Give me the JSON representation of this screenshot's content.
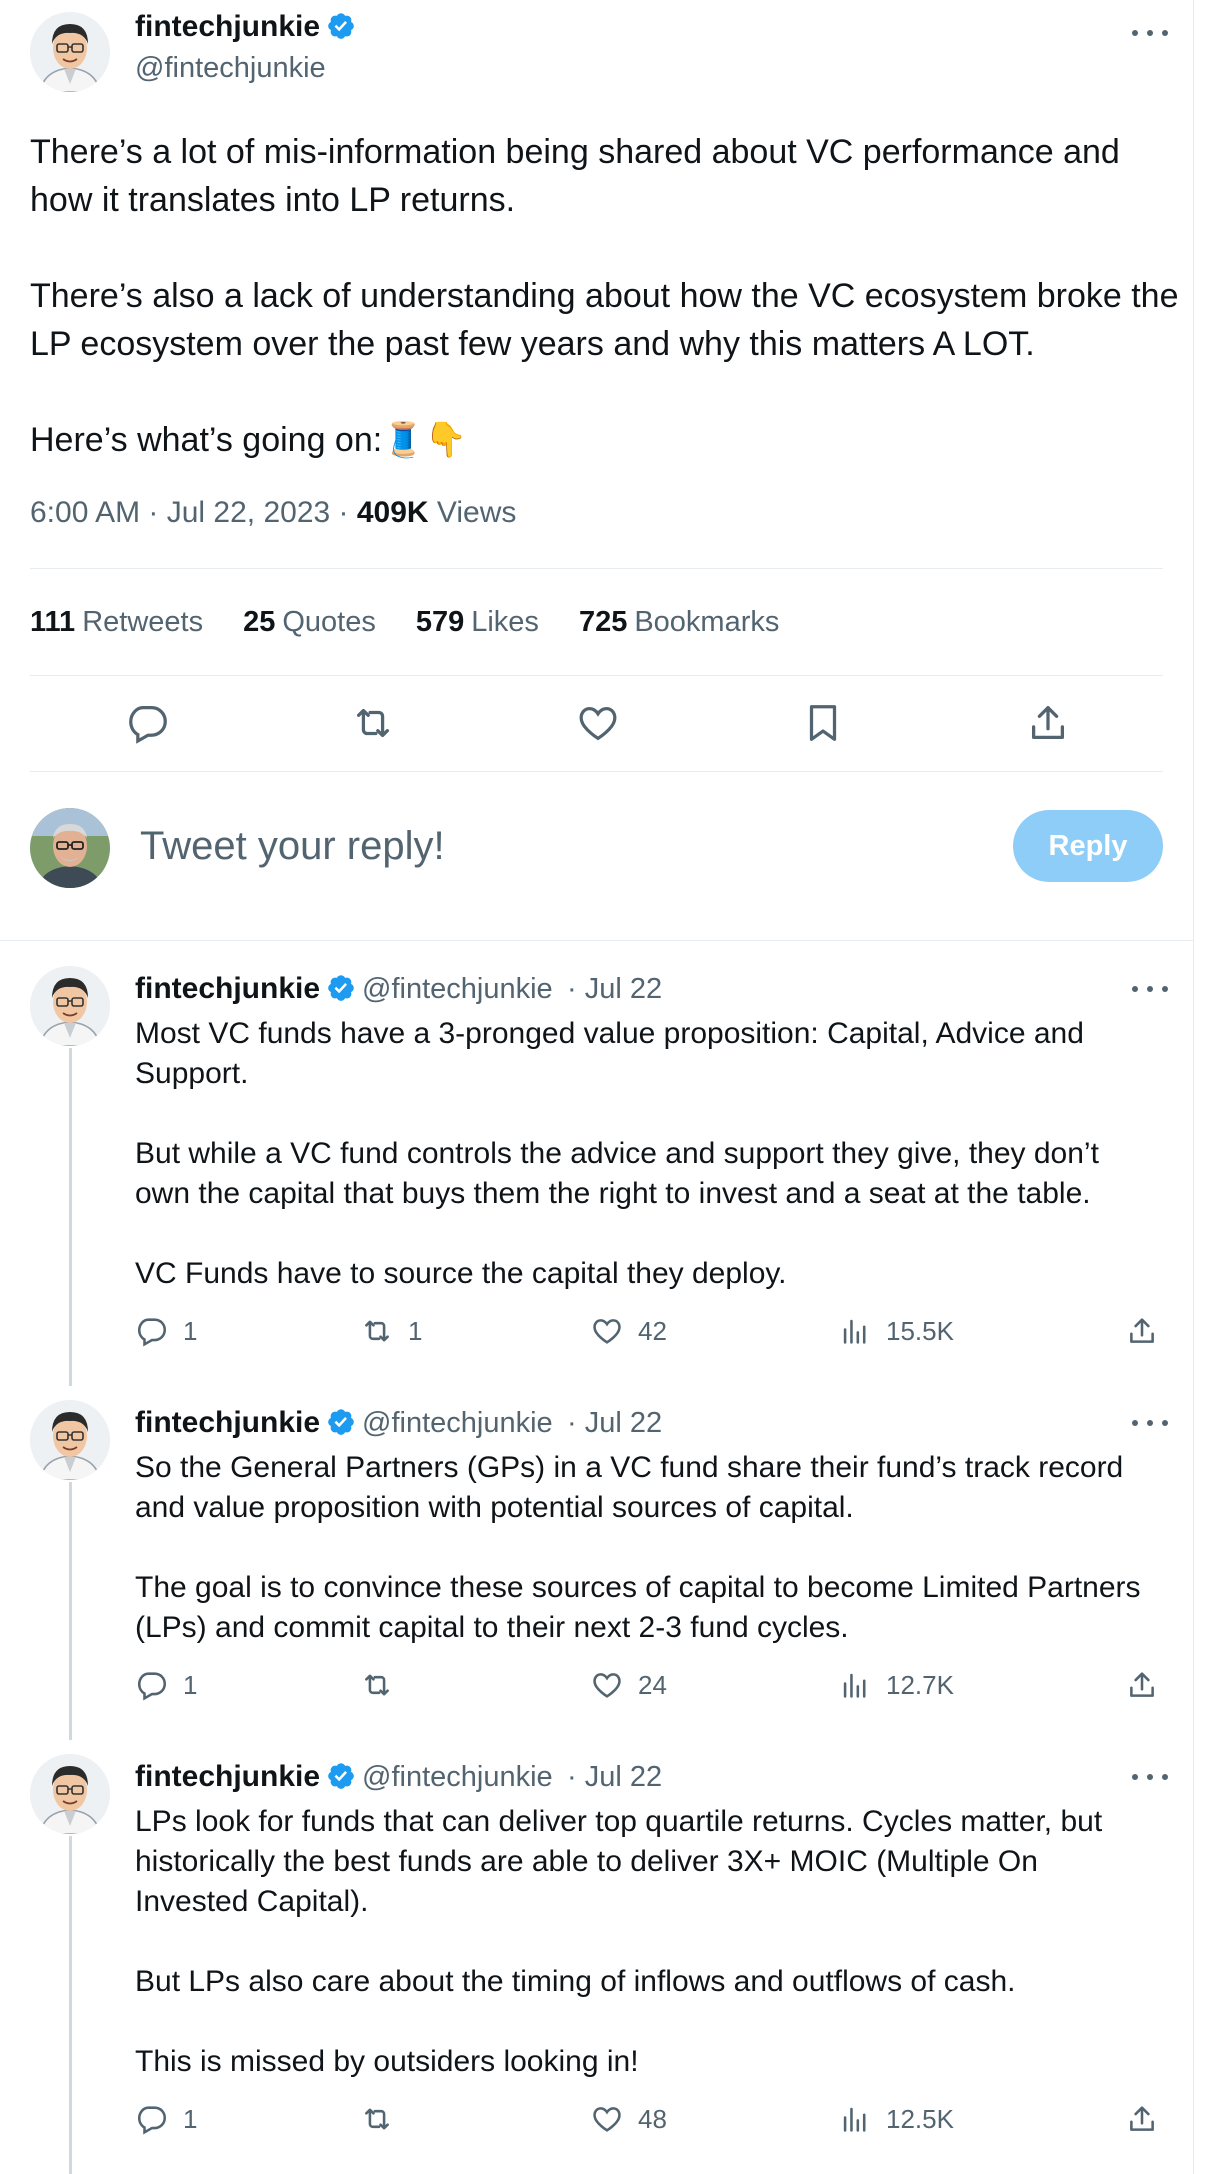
{
  "main_tweet": {
    "author_name": "fintechjunkie",
    "author_handle": "@fintechjunkie",
    "text": "There’s a lot of mis-information being shared about VC performance and how it translates into LP returns.\n\nThere’s also a lack of understanding about how the VC ecosystem broke the LP ecosystem over the past few years and why this matters A LOT.\n\nHere’s what’s going on:🧵👇",
    "time": "6:00 AM · Jul 22, 2023 · ",
    "views_count": "409K",
    "views_label": " Views",
    "stats": [
      {
        "count": "111",
        "label": "Retweets"
      },
      {
        "count": "25",
        "label": "Quotes"
      },
      {
        "count": "579",
        "label": "Likes"
      },
      {
        "count": "725",
        "label": "Bookmarks"
      }
    ]
  },
  "reply_composer": {
    "placeholder": "Tweet your reply!",
    "button_label": "Reply"
  },
  "replies": [
    {
      "author_name": "fintechjunkie",
      "author_handle": "@fintechjunkie",
      "date": "· Jul 22",
      "text": "Most VC funds have a 3-pronged value proposition: Capital, Advice and Support.\n\nBut while a VC fund controls the advice and support they give, they don’t own the capital that buys them the right to invest and a seat at the table.\n\nVC Funds have to source the capital they deploy.",
      "replies": "1",
      "retweets": "1",
      "likes": "42",
      "views": "15.5K"
    },
    {
      "author_name": "fintechjunkie",
      "author_handle": "@fintechjunkie",
      "date": "· Jul 22",
      "text": "So the General Partners (GPs) in a VC fund share their fund’s track record and value proposition with potential sources of capital.\n\nThe goal is to convince these sources of capital to become Limited Partners (LPs) and commit capital to their next 2-3 fund cycles.",
      "replies": "1",
      "retweets": "",
      "likes": "24",
      "views": "12.7K"
    },
    {
      "author_name": "fintechjunkie",
      "author_handle": "@fintechjunkie",
      "date": "· Jul 22",
      "text": "LPs look for funds that can deliver top quartile returns. Cycles matter, but historically the best funds are able to deliver 3X+ MOIC (Multiple On Invested Capital).\n\nBut LPs also care about the timing of inflows and outflows of cash.\n\nThis is missed by outsiders looking in!",
      "replies": "1",
      "retweets": "",
      "likes": "48",
      "views": "12.5K"
    }
  ],
  "colors": {
    "accent": "#1d9bf0",
    "muted": "#536471",
    "reply_button": "#8ecdf8"
  }
}
